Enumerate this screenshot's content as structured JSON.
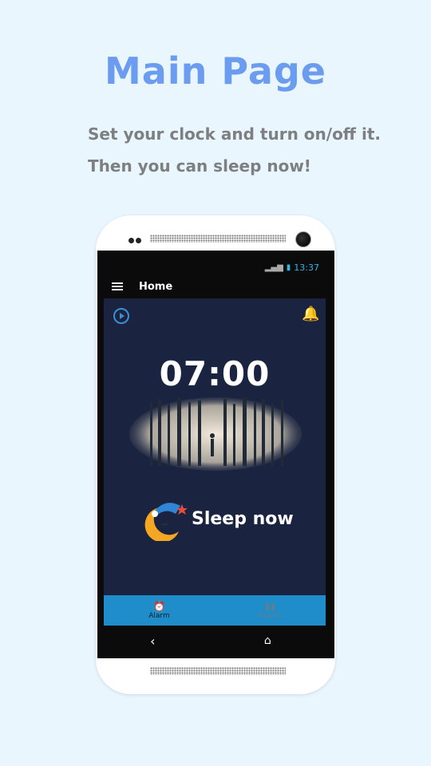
{
  "promo": {
    "title": "Main Page",
    "line1": "Set your clock and turn on/off it.",
    "line2": "Then you can sleep now!"
  },
  "status_bar": {
    "time": "13:37"
  },
  "app_bar": {
    "title": "Home",
    "menu_icon": "hamburger-menu-icon"
  },
  "alarm": {
    "time": "07:00",
    "play_icon": "play-circle-icon",
    "bell_icon": "alarm-bell-icon"
  },
  "sleep": {
    "label": "Sleep now",
    "icon": "moon-nightcap-icon"
  },
  "bottom_nav": {
    "items": [
      {
        "label": "Alarm",
        "icon": "alarm-clock-icon",
        "active": true
      },
      {
        "label": "Report",
        "icon": "bar-chart-icon",
        "active": false
      }
    ]
  },
  "colors": {
    "accent": "#1f8dca",
    "title_blue": "#6b9cf0",
    "content_bg": "#1a2440"
  }
}
